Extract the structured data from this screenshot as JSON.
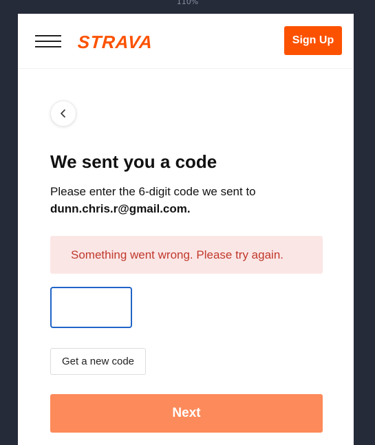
{
  "browser": {
    "zoom": "110%"
  },
  "header": {
    "logo": "STRAVA",
    "signup_label": "Sign Up",
    "brand_color": "#fc5200"
  },
  "page": {
    "title": "We sent you a code",
    "description": "Please enter the 6-digit code we sent to",
    "email": "dunn.chris.r@gmail.com.",
    "error_message": "Something went wrong. Please try again.",
    "code_value": "",
    "new_code_label": "Get a new code",
    "next_label": "Next"
  },
  "icons": {
    "menu": "hamburger-icon",
    "back": "chevron-left-icon"
  },
  "colors": {
    "error_bg": "#fbe6e6",
    "error_text": "#c0392b",
    "next_bg": "#fd8a5a",
    "input_border": "#1f63c7"
  }
}
